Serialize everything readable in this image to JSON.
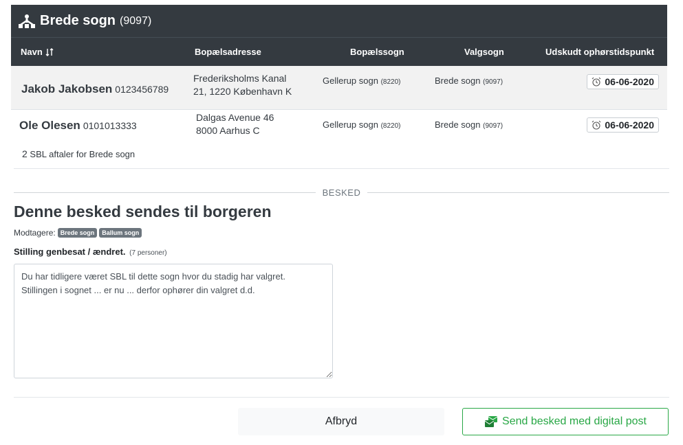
{
  "header": {
    "title": "Brede sogn",
    "count": "(9097)"
  },
  "columns": {
    "name": "Navn",
    "address": "Bopælsadresse",
    "residence_parish": "Bopælssogn",
    "voting_parish": "Valgsogn",
    "deadline": "Udskudt ophørstidspunkt"
  },
  "rows": [
    {
      "name": "Jakob Jakobsen",
      "cpr": "0123456789",
      "address_line1": "Frederiksholms Kanal",
      "address_line2": "21, 1220 København K",
      "residence_parish": "Gellerup sogn",
      "residence_parish_code": "(8220)",
      "voting_parish": "Brede sogn",
      "voting_parish_code": "(9097)",
      "date": "06-06-2020"
    },
    {
      "name": "Ole Olesen",
      "cpr": "0101013333",
      "address_line1": "Dalgas Avenue 46",
      "address_line2": "8000 Aarhus C",
      "residence_parish": "Gellerup sogn",
      "residence_parish_code": "(8220)",
      "voting_parish": "Brede sogn",
      "voting_parish_code": "(9097)",
      "date": "06-06-2020"
    }
  ],
  "summary": {
    "count": "2",
    "text": "SBL aftaler for Brede sogn"
  },
  "message": {
    "divider_label": "BESKED",
    "title": "Denne besked sendes til borgeren",
    "recipients_label": "Modtagere:",
    "recipients": [
      "Brede sogn",
      "Ballum sogn"
    ],
    "subject": "Stilling genbesat / ændret.",
    "subject_count": "(7 personer)",
    "body": "Du har tidligere været SBL til dette sogn hvor du stadig har valgret.\nStillingen i sognet ... er nu ... derfor ophører din valgret d.d."
  },
  "buttons": {
    "cancel": "Afbryd",
    "send": "Send besked med digital post"
  },
  "colors": {
    "dark": "#343a40",
    "success": "#28a745",
    "badge": "#6c757d"
  },
  "icons": {
    "header": "sitemap-icon",
    "sort": "sort-icon",
    "date": "alarm-clock-icon",
    "send": "mail-send-icon"
  }
}
